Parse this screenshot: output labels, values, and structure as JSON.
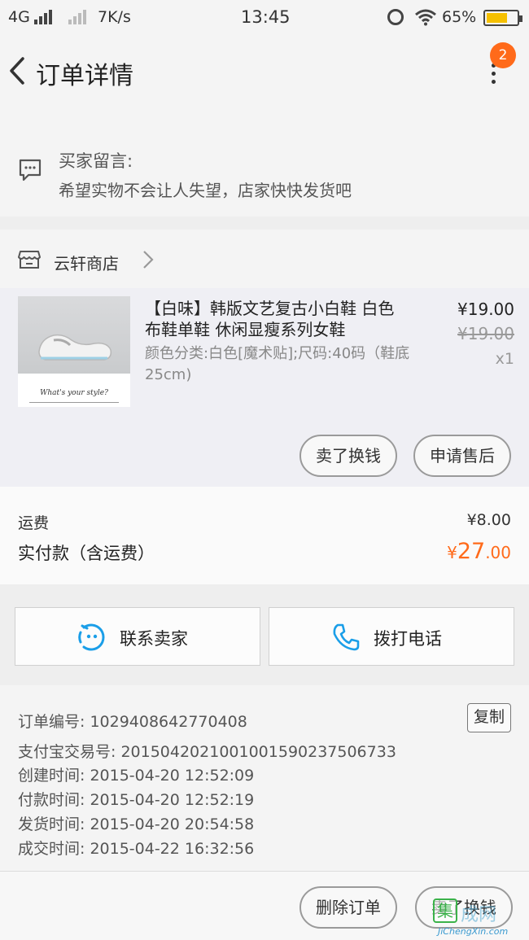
{
  "status_bar": {
    "network": "4G",
    "speed": "7K/s",
    "time": "13:45",
    "battery": "65%"
  },
  "header": {
    "title": "订单详情",
    "badge_count": "2"
  },
  "buyer_message": {
    "label": "买家留言:",
    "text": "希望实物不会让人失望，店家快快发货吧"
  },
  "store": {
    "name": "云轩商店"
  },
  "item": {
    "image_caption": "What's your style?",
    "title": "【白味】韩版文艺复古小白鞋 白色布鞋单鞋 休闲显瘦系列女鞋",
    "spec": "颜色分类:白色[魔术贴];尺码:40码（鞋底25cm)",
    "price": "¥19.00",
    "original_price": "¥19.00",
    "quantity": "x1",
    "sell_label": "卖了换钱",
    "after_sale_label": "申请售后"
  },
  "totals": {
    "shipping_label": "运费",
    "shipping_value": "¥8.00",
    "paid_label": "实付款（含运费）",
    "paid_currency": "¥",
    "paid_integer": "27",
    "paid_decimal": ".00"
  },
  "contact": {
    "seller_label": "联系卖家",
    "call_label": "拨打电话"
  },
  "order_info": {
    "order_no": "订单编号: 1029408642770408",
    "copy_label": "复制",
    "alipay_no": "支付宝交易号: 2015042021001001590237506733",
    "created": "创建时间: 2015-04-20 12:52:09",
    "paid": "付款时间: 2015-04-20 12:52:19",
    "shipped": "发货时间: 2015-04-20 20:54:58",
    "completed": "成交时间: 2015-04-22 16:32:56"
  },
  "bottom": {
    "delete_label": "删除订单",
    "sell_label": "卖了换钱"
  },
  "watermark": {
    "box_char": "集",
    "text_cn": "成网",
    "text_en": "JiChengXin.com"
  },
  "colors": {
    "accent": "#ff6a1a",
    "icon_blue": "#1a9ee8"
  }
}
